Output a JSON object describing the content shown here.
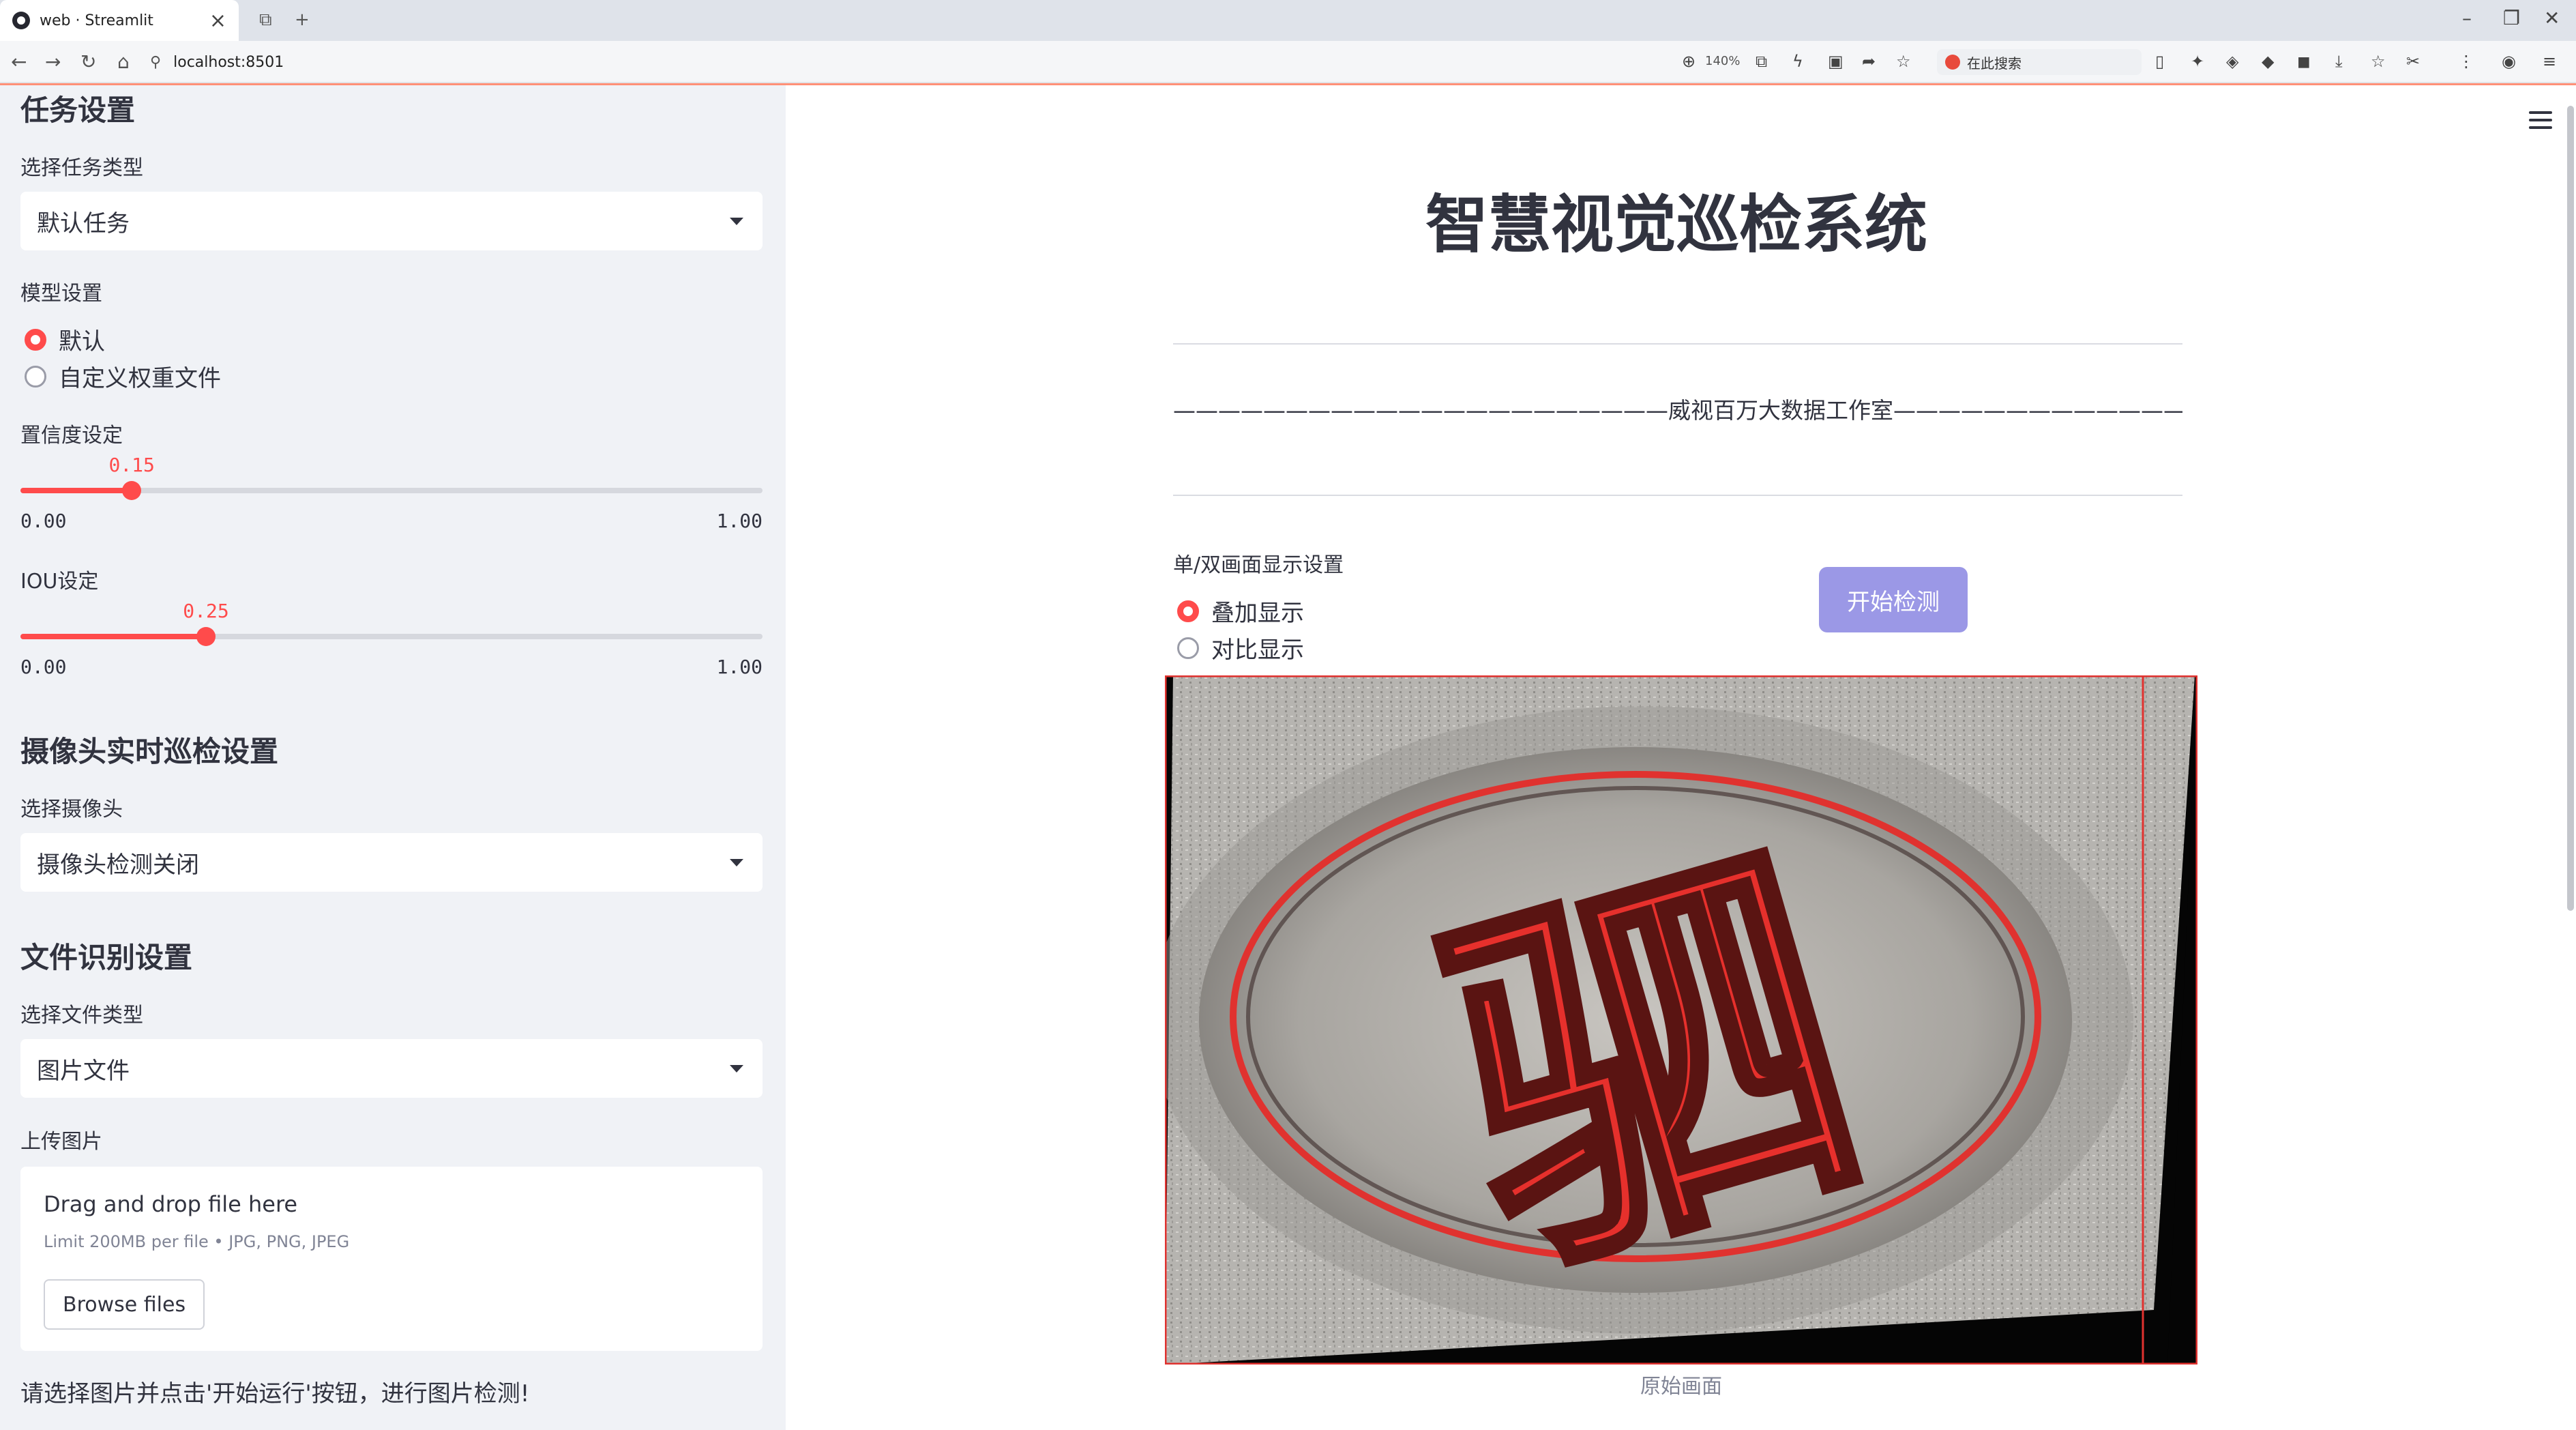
{
  "browser": {
    "tab_title": "web · Streamlit",
    "tab_close": "×",
    "new_tab": "+",
    "url": "localhost:8501",
    "zoom": "140%",
    "search_placeholder": "在此搜索"
  },
  "sidebar": {
    "task_heading": "任务设置",
    "task_type_label": "选择任务类型",
    "task_type_value": "默认任务",
    "model_label": "模型设置",
    "model_options": [
      "默认",
      "自定义权重文件"
    ],
    "model_selected": 0,
    "confidence": {
      "label": "置信度设定",
      "value": "0.15",
      "min": "0.00",
      "max": "1.00",
      "fraction": 0.15
    },
    "iou": {
      "label": "IOU设定",
      "value": "0.25",
      "min": "0.00",
      "max": "1.00",
      "fraction": 0.25
    },
    "camera_heading": "摄像头实时巡检设置",
    "camera_label": "选择摄像头",
    "camera_value": "摄像头检测关闭",
    "file_heading": "文件识别设置",
    "file_type_label": "选择文件类型",
    "file_type_value": "图片文件",
    "upload_label": "上传图片",
    "upload_title": "Drag and drop file here",
    "upload_limit": "Limit 200MB per file • JPG, PNG, JPEG",
    "browse_label": "Browse files",
    "note": "请选择图片并点击'开始运行'按钮，进行图片检测!"
  },
  "main": {
    "title": "智慧视觉巡检系统",
    "studio": "——————————————————————威视百万大数据工作室———————————————————————",
    "display_label": "单/双画面显示设置",
    "display_options": [
      "叠加显示",
      "对比显示"
    ],
    "display_selected": 0,
    "start_button": "开始检测",
    "image_caption": "原始画面",
    "image_character": "驷"
  },
  "colors": {
    "accent": "#ff4b4b",
    "button": "#9b98e6",
    "sidebar_bg": "#f0f2f6",
    "text": "#31333f"
  }
}
